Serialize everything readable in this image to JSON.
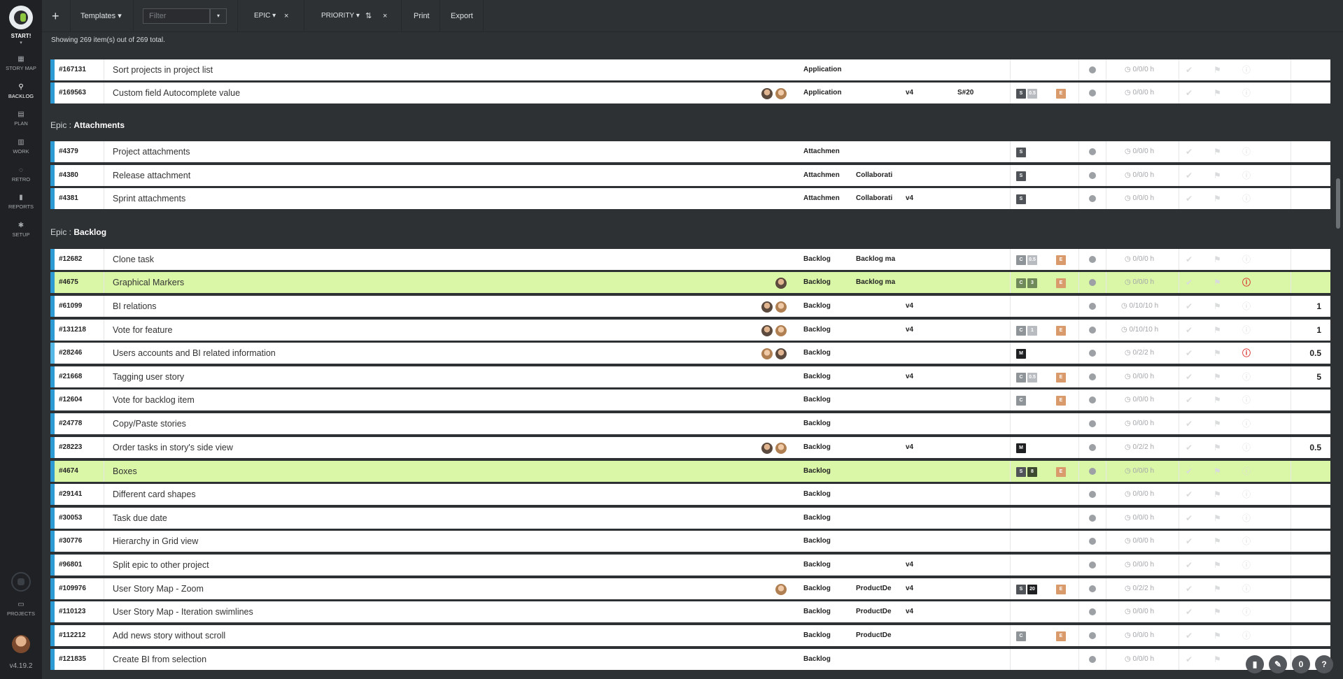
{
  "sidebar": {
    "logo_label": "START!",
    "logo_caret": "▾",
    "nav": [
      {
        "icon": "▦",
        "label": "STORY MAP"
      },
      {
        "icon": "⚲",
        "label": "BACKLOG"
      },
      {
        "icon": "▤",
        "label": "PLAN"
      },
      {
        "icon": "▥",
        "label": "WORK"
      },
      {
        "icon": "◌",
        "label": "RETRO"
      },
      {
        "icon": "▮",
        "label": "REPORTS"
      },
      {
        "icon": "✱",
        "label": "SETUP"
      }
    ],
    "projects_icon": "▭",
    "projects_label": "PROJECTS",
    "version": "v4.19.2"
  },
  "toolbar": {
    "add": "+",
    "templates": "Templates ▾",
    "filter_placeholder": "Filter",
    "filter_caret": "▾",
    "epic": "EPIC ▾",
    "epic_close": "×",
    "priority": "PRIORITY ▾",
    "priority_sort": "⇅",
    "priority_close": "×",
    "print": "Print",
    "export": "Export"
  },
  "summary": "Showing 269 item(s) out of 269 total.",
  "epics": {
    "e1_prefix": "Epic : ",
    "e1_name": "Attachments",
    "e2_prefix": "Epic : ",
    "e2_name": "Backlog"
  },
  "rows": {
    "r0": {
      "id": "#167131",
      "title": "Sort projects in project list",
      "app": "Application",
      "comp": "",
      "rel": "",
      "spr": "",
      "est": "◷ 0/0/0 h",
      "pts": ""
    },
    "r1": {
      "id": "#169563",
      "title": "Custom field Autocomplete value",
      "app": "Application",
      "comp": "",
      "rel": "v4",
      "spr": "S#20",
      "est": "◷ 0/0/0 h",
      "pts": ""
    },
    "r2": {
      "id": "#4379",
      "title": "Project attachments",
      "app": "Attachmen",
      "comp": "",
      "rel": "",
      "spr": "",
      "est": "◷ 0/0/0 h",
      "pts": ""
    },
    "r3": {
      "id": "#4380",
      "title": "Release attachment",
      "app": "Attachmen",
      "comp": "Collaborati",
      "rel": "",
      "spr": "",
      "est": "◷ 0/0/0 h",
      "pts": ""
    },
    "r4": {
      "id": "#4381",
      "title": "Sprint attachments",
      "app": "Attachmen",
      "comp": "Collaborati",
      "rel": "v4",
      "spr": "",
      "est": "◷ 0/0/0 h",
      "pts": ""
    },
    "r5": {
      "id": "#12682",
      "title": "Clone task",
      "app": "Backlog",
      "comp": "Backlog ma",
      "rel": "",
      "spr": "",
      "est": "◷ 0/0/0 h",
      "pts": ""
    },
    "r6": {
      "id": "#4675",
      "title": "Graphical Markers",
      "app": "Backlog",
      "comp": "Backlog ma",
      "rel": "",
      "spr": "",
      "est": "◷ 0/0/0 h",
      "pts": ""
    },
    "r7": {
      "id": "#61099",
      "title": "BI relations",
      "app": "Backlog",
      "comp": "",
      "rel": "v4",
      "spr": "",
      "est": "◷ 0/10/10 h",
      "pts": "1"
    },
    "r8": {
      "id": "#131218",
      "title": "Vote for feature",
      "app": "Backlog",
      "comp": "",
      "rel": "v4",
      "spr": "",
      "est": "◷ 0/10/10 h",
      "pts": "1"
    },
    "r9": {
      "id": "#28246",
      "title": "Users accounts and BI related information",
      "app": "Backlog",
      "comp": "",
      "rel": "",
      "spr": "",
      "est": "◷ 0/2/2 h",
      "pts": "0.5"
    },
    "r10": {
      "id": "#21668",
      "title": "Tagging user story",
      "app": "Backlog",
      "comp": "",
      "rel": "v4",
      "spr": "",
      "est": "◷ 0/0/0 h",
      "pts": "5"
    },
    "r11": {
      "id": "#12604",
      "title": "Vote for backlog item",
      "app": "Backlog",
      "comp": "",
      "rel": "",
      "spr": "",
      "est": "◷ 0/0/0 h",
      "pts": ""
    },
    "r12": {
      "id": "#24778",
      "title": "Copy/Paste stories",
      "app": "Backlog",
      "comp": "",
      "rel": "",
      "spr": "",
      "est": "◷ 0/0/0 h",
      "pts": ""
    },
    "r13": {
      "id": "#28223",
      "title": "Order tasks in story's side view",
      "app": "Backlog",
      "comp": "",
      "rel": "v4",
      "spr": "",
      "est": "◷ 0/2/2 h",
      "pts": "0.5"
    },
    "r14": {
      "id": "#4674",
      "title": "Boxes",
      "app": "Backlog",
      "comp": "",
      "rel": "",
      "spr": "",
      "est": "◷ 0/0/0 h",
      "pts": ""
    },
    "r15": {
      "id": "#29141",
      "title": "Different card shapes",
      "app": "Backlog",
      "comp": "",
      "rel": "",
      "spr": "",
      "est": "◷ 0/0/0 h",
      "pts": ""
    },
    "r16": {
      "id": "#30053",
      "title": "Task due date",
      "app": "Backlog",
      "comp": "",
      "rel": "",
      "spr": "",
      "est": "◷ 0/0/0 h",
      "pts": ""
    },
    "r17": {
      "id": "#30776",
      "title": "Hierarchy in Grid view",
      "app": "Backlog",
      "comp": "",
      "rel": "",
      "spr": "",
      "est": "◷ 0/0/0 h",
      "pts": ""
    },
    "r18": {
      "id": "#96801",
      "title": "Split epic to other project",
      "app": "Backlog",
      "comp": "",
      "rel": "v4",
      "spr": "",
      "est": "◷ 0/0/0 h",
      "pts": ""
    },
    "r19": {
      "id": "#109976",
      "title": "User Story Map - Zoom",
      "app": "Backlog",
      "comp": "ProductDe",
      "rel": "v4",
      "spr": "",
      "est": "◷ 0/2/2 h",
      "pts": ""
    },
    "r20": {
      "id": "#110123",
      "title": "User Story Map - Iteration swimlines",
      "app": "Backlog",
      "comp": "ProductDe",
      "rel": "v4",
      "spr": "",
      "est": "◷ 0/0/0 h",
      "pts": ""
    },
    "r21": {
      "id": "#112212",
      "title": "Add news story without scroll",
      "app": "Backlog",
      "comp": "ProductDe",
      "rel": "",
      "spr": "",
      "est": "◷ 0/0/0 h",
      "pts": ""
    },
    "r22": {
      "id": "#121835",
      "title": "Create BI from selection",
      "app": "Backlog",
      "comp": "",
      "rel": "",
      "spr": "",
      "est": "◷ 0/0/0 h",
      "pts": ""
    }
  },
  "badges": {
    "s": "S",
    "c": "C",
    "m": "M",
    "e": "E",
    "v05": "0.5",
    "v3": "3",
    "v1": "1",
    "v8": "8",
    "v20": "20"
  },
  "icons": {
    "check": "✔",
    "flag": "⚑",
    "info": "ⓘ",
    "alert": "⓵"
  },
  "fab": {
    "zero": "0",
    "help": "?",
    "edit": "✎",
    "note": "▮"
  }
}
